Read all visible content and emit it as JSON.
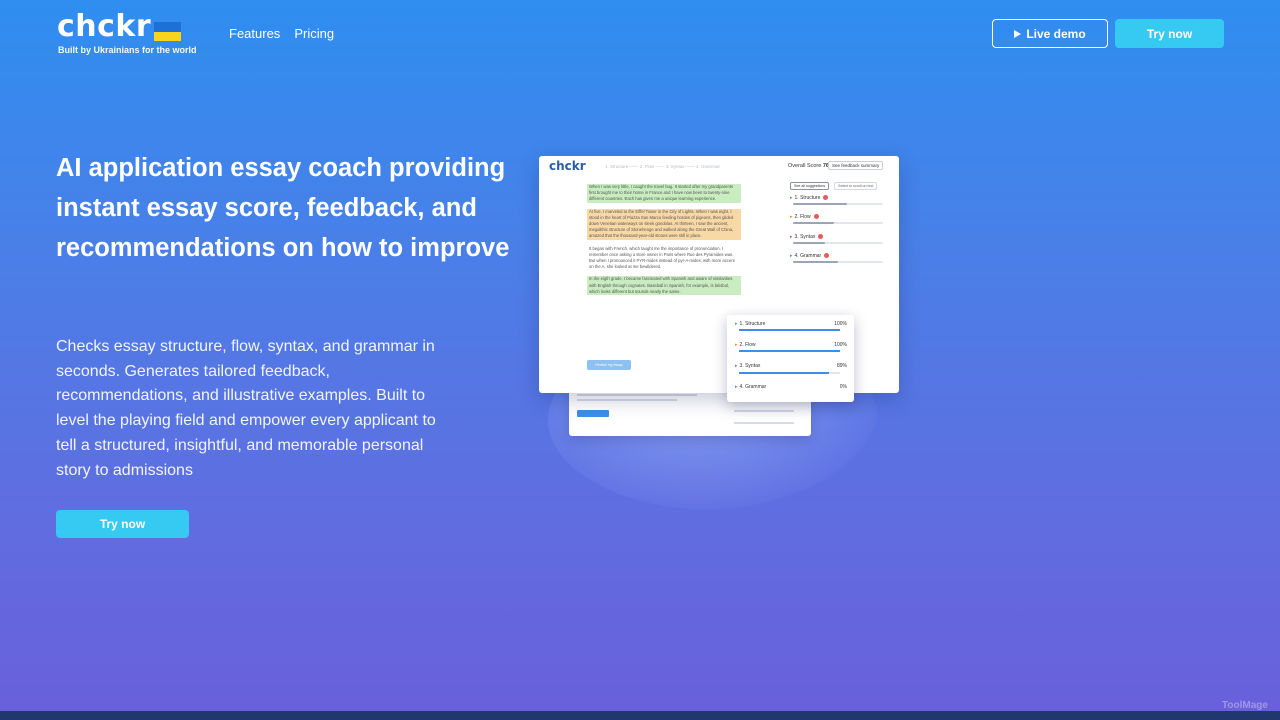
{
  "header": {
    "logo_text": "chckr",
    "tagline": "Built by Ukrainians for the world",
    "flag_colors": {
      "top": "#1e6fd6",
      "bottom": "#f7d51d"
    },
    "nav": [
      {
        "label": "Features"
      },
      {
        "label": "Pricing"
      }
    ],
    "live_demo_label": "Live demo",
    "try_now_label": "Try now"
  },
  "hero": {
    "title": "AI application essay coach providing instant essay score, feedback, and recommendations on how to improve",
    "description": "Checks essay structure, flow, syntax, and grammar in seconds. Generates tailored feedback, recommendations, and illustrative examples. Built to level the playing field and empower every applicant to tell a structured, insightful, and memorable personal story to admissions",
    "cta_label": "Try now"
  },
  "preview": {
    "logo_text": "chckr",
    "steps": "1. Structure —— 2. Flow —— 3. Syntax —— 4. Grammar",
    "overall_score_label": "Overall Score",
    "overall_score_value": "76",
    "summary_button": "See feedback summary",
    "tabs": [
      "See all suggestions",
      "Select to scroll on text"
    ],
    "essay_paragraphs": [
      "When I was very little, I caught the travel bug. It started after my grandparents first brought me to their home in France and I have now been to twenty-nine different countries. Each has given me a unique learning experience.",
      "At five, I marveled to the Eiffel Tower in the City of Lights. When I was eight, I stood in the heart of Piazza San Marco feeding hordes of pigeons, then glided down Venetian waterways on sleek gondolas. At thirteen, I saw the ancient, megalithic structure of Stonehenge and walked along the Great Wall of China, amazed that the thousand-year-old stones were still in place.",
      "It began with French, which taught me the importance of pronunciation. I remember once asking a store owner in Paris where Rue des Pyramides was. But when I pronounced it PYR-mides instead of pyr-A-mides, with more accent on the A, she looked at me bewildered.",
      "In the eigth grade, I became fascinated with Spanish and aware of similarities with English through cognates. Baseball in Spanish, for example, is béisbol, which looks different but sounds nearly the same."
    ],
    "review_button": "Review my essay",
    "categories": [
      {
        "label": "1. Structure",
        "progress": 0.6
      },
      {
        "label": "2. Flow",
        "progress": 0.45
      },
      {
        "label": "3. Syntax",
        "progress": 0.35
      },
      {
        "label": "4. Grammar",
        "progress": 0.5
      }
    ],
    "popup_scores": [
      {
        "label": "1. Structure",
        "value": "100%",
        "progress": 1.0,
        "arrow_color": "#3fae5a"
      },
      {
        "label": "2. Flow",
        "value": "100%",
        "progress": 1.0,
        "arrow_color": "#f08a24"
      },
      {
        "label": "3. Syntax",
        "value": "89%",
        "progress": 0.89,
        "arrow_color": "#8f5fd8"
      },
      {
        "label": "4. Grammar",
        "value": "0%",
        "progress": 0.0,
        "arrow_color": "#3d8ee8"
      }
    ],
    "back_card_button": "Review my essay"
  },
  "watermark": "ToolMage"
}
